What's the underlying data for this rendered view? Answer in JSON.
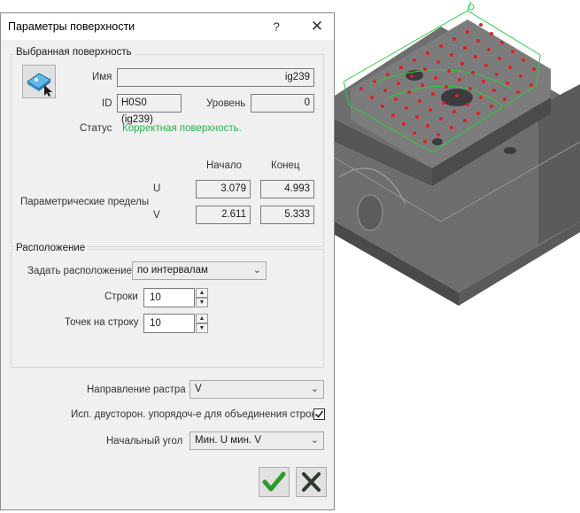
{
  "dialog": {
    "title": "Параметры поверхности",
    "help_label": "?",
    "close_label": "✕"
  },
  "selected_surface": {
    "group_label": "Выбранная поверхность",
    "name_label": "Имя",
    "name_value": "ig239",
    "id_label": "ID",
    "id_value": "H0S0 (ig239)",
    "level_label": "Уровень",
    "level_value": "0",
    "status_label": "Статус",
    "status_value": "Корректная поверхность.",
    "status_color": "#22b14c",
    "start_header": "Начало",
    "end_header": "Конец",
    "params_label": "Параметрические пределы",
    "u_label": "U",
    "u_start": "3.079",
    "u_end": "4.993",
    "v_label": "V",
    "v_start": "2.611",
    "v_end": "5.333",
    "icon": "surface-select-icon"
  },
  "placement": {
    "group_label": "Расположение",
    "set_label": "Задать расположение",
    "set_value": "по интервалам",
    "rows_label": "Строки",
    "rows_value": "10",
    "points_label": "Точек на строку",
    "points_value": "10"
  },
  "raster_direction": {
    "label": "Направление растра",
    "value": "V"
  },
  "bidirectional": {
    "label": "Исп. двусторон. упорядоч-е для объединения строк",
    "checked": true
  },
  "start_angle": {
    "label": "Начальный угол",
    "value": "Мин. U мин. V"
  },
  "buttons": {
    "ok_icon": "checkmark-icon",
    "cancel_icon": "x-cross-icon",
    "accent": "#2e9a2e"
  }
}
